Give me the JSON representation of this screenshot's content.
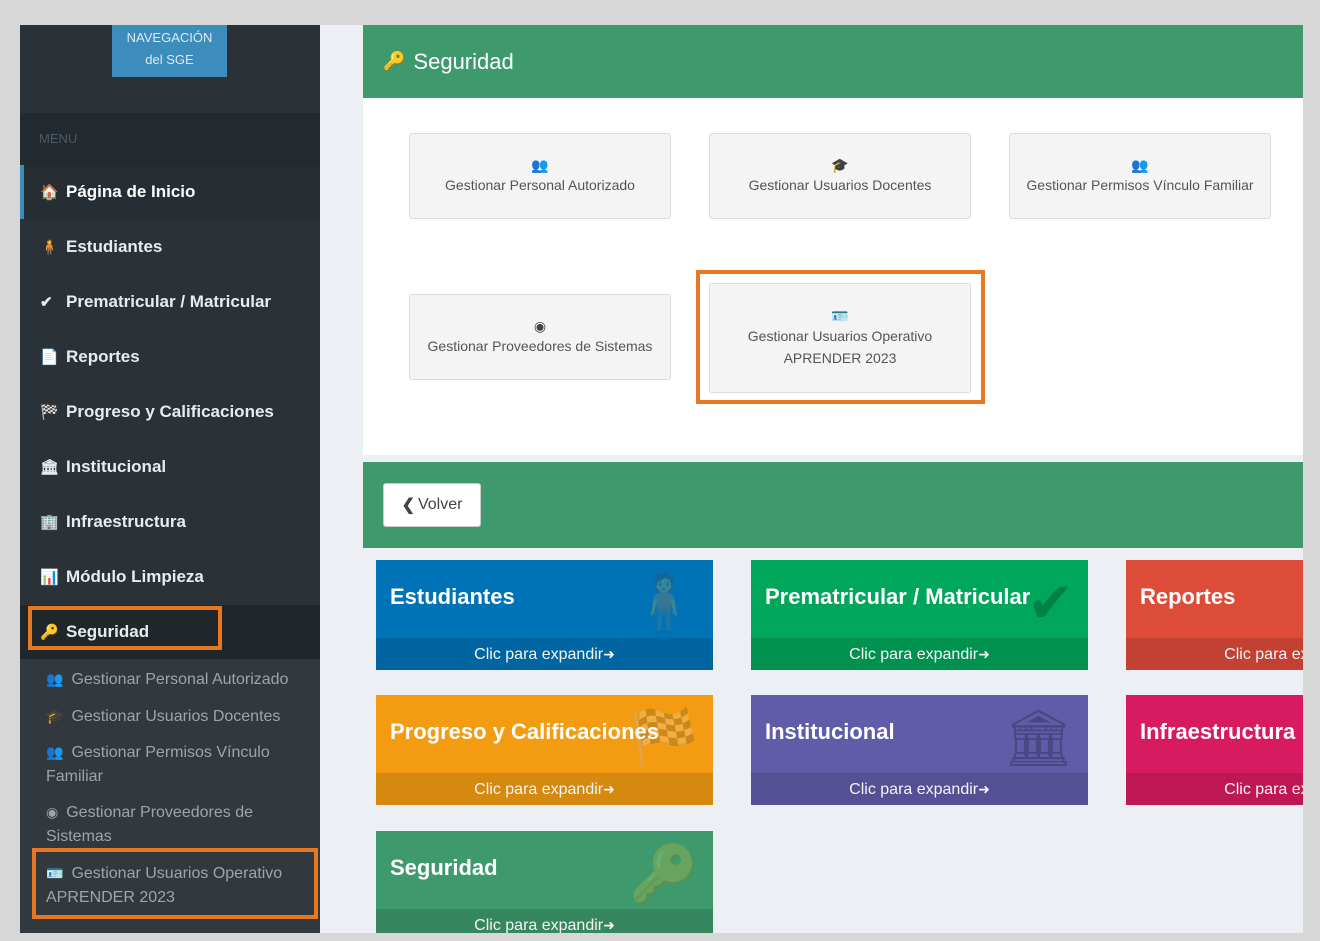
{
  "sidebar": {
    "logo_line1": "NAVEGACIÓN",
    "logo_line2": "del SGE",
    "menu_header": "MENU",
    "items": [
      {
        "icon": "home-icon",
        "glyph": "🏠",
        "label": "Página de Inicio"
      },
      {
        "icon": "student-icon",
        "glyph": "🧍",
        "label": "Estudiantes"
      },
      {
        "icon": "check-icon",
        "glyph": "✔",
        "label": "Prematricular / Matricular"
      },
      {
        "icon": "report-icon",
        "glyph": "📄",
        "label": "Reportes"
      },
      {
        "icon": "flag-icon",
        "glyph": "🏁",
        "label": "Progreso y Calificaciones"
      },
      {
        "icon": "institution-icon",
        "glyph": "🏛",
        "label": "Institucional"
      },
      {
        "icon": "building-icon",
        "glyph": "🏢",
        "label": "Infraestructura"
      },
      {
        "icon": "bar-chart-icon",
        "glyph": "📊",
        "label": "Módulo Limpieza"
      },
      {
        "icon": "key-icon",
        "glyph": "🔑",
        "label": "Seguridad"
      }
    ],
    "sub_items": [
      {
        "icon": "users-icon",
        "glyph": "👥",
        "label": "Gestionar Personal Autorizado"
      },
      {
        "icon": "graduation-cap-icon",
        "glyph": "🎓",
        "label": "Gestionar Usuarios Docentes"
      },
      {
        "icon": "users-icon",
        "glyph": "👥",
        "label": "Gestionar Permisos Vínculo Familiar"
      },
      {
        "icon": "user-circle-icon",
        "glyph": "◉",
        "label": "Gestionar Proveedores de Sistemas"
      },
      {
        "icon": "id-card-icon",
        "glyph": "🪪",
        "label": "Gestionar Usuarios Operativo APRENDER 2023"
      }
    ]
  },
  "panel": {
    "title": "Seguridad",
    "title_icon": "🔑",
    "buttons": [
      {
        "glyph": "👥",
        "label": "Gestionar Personal Autorizado"
      },
      {
        "glyph": "🎓",
        "label": "Gestionar Usuarios Docentes"
      },
      {
        "glyph": "👥",
        "label": "Gestionar Permisos Vínculo Familiar"
      },
      {
        "glyph": "◉",
        "label": "Gestionar Proveedores de Sistemas"
      },
      {
        "glyph": "🪪",
        "label": "Gestionar Usuarios Operativo APRENDER 2023"
      }
    ],
    "back_label": "Volver",
    "back_glyph": "❮"
  },
  "tiles": [
    {
      "title": "Estudiantes",
      "footer": "Clic para expandir",
      "color": "#0073b7",
      "glyph": "🧍"
    },
    {
      "title": "Prematricular / Matricular",
      "footer": "Clic para expandir",
      "color": "#00a65a",
      "glyph": "✔"
    },
    {
      "title": "Reportes",
      "footer": "Clic para expandir",
      "color": "#dd4b39",
      "glyph": "📄"
    },
    {
      "title": "Progreso y Calificaciones",
      "footer": "Clic para expandir",
      "color": "#f39c12",
      "glyph": "🏁"
    },
    {
      "title": "Institucional",
      "footer": "Clic para expandir",
      "color": "#605ca8",
      "glyph": "🏛"
    },
    {
      "title": "Infraestructura",
      "footer": "Clic para expandir",
      "color": "#d81b60",
      "glyph": "🏢"
    },
    {
      "title": "Seguridad",
      "footer": "Clic para expandir",
      "color": "#3e9a6d",
      "glyph": "🔑"
    }
  ],
  "expand_glyph": "➜",
  "highlight_color": "#e87722"
}
